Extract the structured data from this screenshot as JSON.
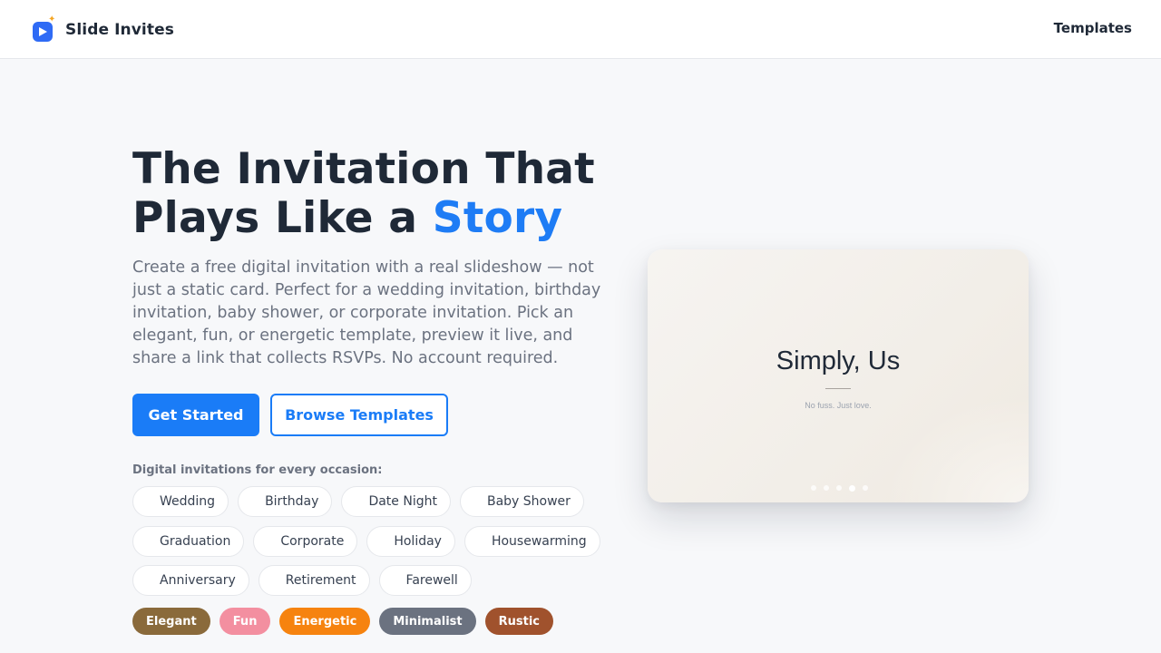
{
  "header": {
    "brand_name": "Slide Invites",
    "nav_templates": "Templates"
  },
  "hero": {
    "title_part1": "The Invitation That Plays Like a ",
    "title_accent": "Story",
    "description": "Create a free digital invitation with a real slideshow — not just a static card. Perfect for a wedding invitation, birthday invitation, baby shower, or corporate invitation. Pick an elegant, fun, or energetic template, preview it live, and share a link that collects RSVPs. No account required.",
    "primary_button": "Get Started",
    "secondary_button": "Browse Templates",
    "occasions_label": "Digital invitations for every occasion:",
    "occasions_row1": [
      "Wedding",
      "Birthday",
      "Date Night",
      "Baby Shower"
    ],
    "occasions_row2": [
      "Graduation",
      "Corporate",
      "Holiday",
      "Housewarming"
    ],
    "occasions_row3": [
      "Anniversary",
      "Retirement",
      "Farewell"
    ],
    "styles": [
      {
        "label": "Elegant",
        "color": "#8a6a3b"
      },
      {
        "label": "Fun",
        "color": "#f38fa0"
      },
      {
        "label": "Energetic",
        "color": "#f6830f"
      },
      {
        "label": "Minimalist",
        "color": "#6b7280"
      },
      {
        "label": "Rustic",
        "color": "#a0522d"
      }
    ]
  },
  "preview": {
    "slide_title": "Simply, Us",
    "slide_subtitle": "No fuss. Just love.",
    "slide_count": 5,
    "active_slide": 4
  },
  "colors": {
    "accent": "#1a7cf7",
    "brand_icon": "#2f6bf5"
  }
}
